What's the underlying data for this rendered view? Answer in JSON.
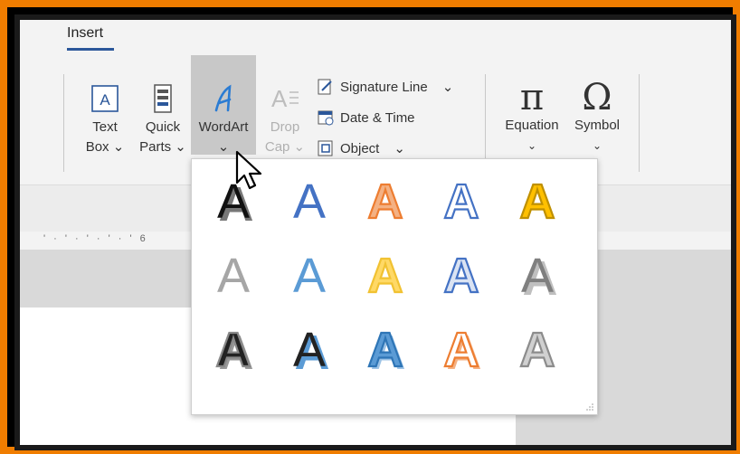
{
  "tab": {
    "label": "Insert"
  },
  "ribbon": {
    "text_box": {
      "line1": "Text",
      "line2": "Box ⌄"
    },
    "quick_parts": {
      "line1": "Quick",
      "line2": "Parts ⌄"
    },
    "wordart": {
      "line1": "WordArt",
      "line2": "⌄"
    },
    "drop_cap": {
      "line1": "Drop",
      "line2": "Cap ⌄"
    },
    "signature_line": {
      "label": "Signature Line",
      "caret": "⌄"
    },
    "date_time": {
      "label": "Date & Time"
    },
    "object": {
      "label": "Object",
      "caret": "⌄"
    },
    "equation": {
      "glyph": "π",
      "label": "Equation",
      "caret": "⌄"
    },
    "symbol": {
      "glyph": "Ω",
      "label": "Symbol",
      "caret": "⌄"
    }
  },
  "ruler": {
    "marks": "' · ' · ' · ' · ' 6"
  },
  "wordart_gallery": {
    "letter": "A",
    "styles": [
      {
        "name": "fill-black-shadow"
      },
      {
        "name": "fill-blue"
      },
      {
        "name": "fill-orange-outline"
      },
      {
        "name": "outline-blue-white"
      },
      {
        "name": "fill-gold"
      },
      {
        "name": "fill-gray"
      },
      {
        "name": "gradient-blue-reflection"
      },
      {
        "name": "fill-gold-light"
      },
      {
        "name": "outline-blue-inner"
      },
      {
        "name": "fill-gray-shadow"
      },
      {
        "name": "black-bevel-shadow"
      },
      {
        "name": "black-blue-shadow"
      },
      {
        "name": "blue-bevel"
      },
      {
        "name": "orange-outline-shadow"
      },
      {
        "name": "silver-gradient"
      }
    ]
  },
  "colors": {
    "frame": "#f07d00",
    "accent": "#2b579a",
    "wordart_blue": "#4472c4",
    "wordart_orange": "#ed7d31",
    "wordart_gold": "#ffc000"
  }
}
